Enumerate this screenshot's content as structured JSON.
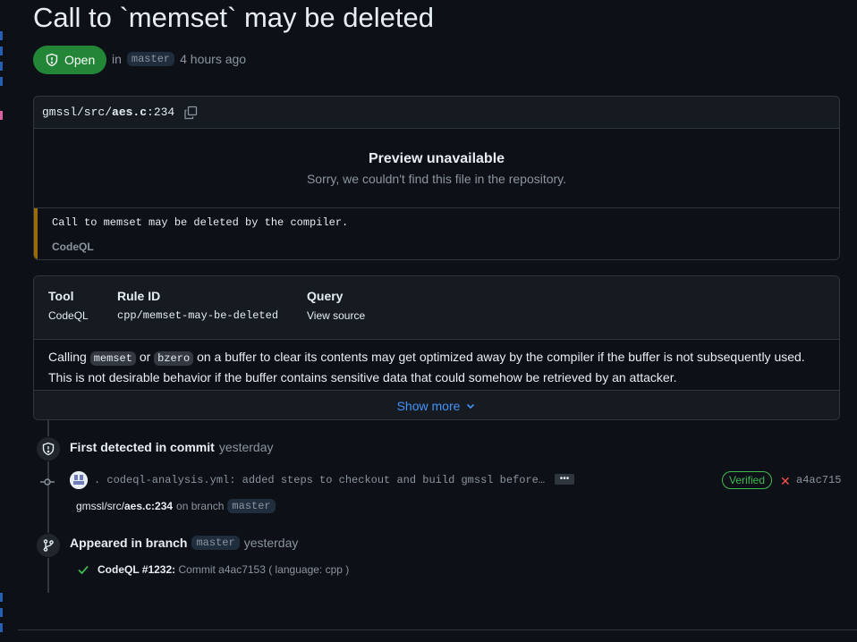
{
  "alert": {
    "title": "Call to `memset` may be deleted",
    "status": "Open",
    "in_label": "in",
    "branch": "master",
    "time_ago": "4 hours ago"
  },
  "file": {
    "path_prefix": "gmssl/src/",
    "filename": "aes.c",
    "line": ":234",
    "preview_title": "Preview unavailable",
    "preview_message": "Sorry, we couldn't find this file in the repository.",
    "alert_message": "Call to memset may be deleted by the compiler.",
    "alert_tool": "CodeQL"
  },
  "rule": {
    "tool_header": "Tool",
    "tool_value": "CodeQL",
    "rule_id_header": "Rule ID",
    "rule_id_value": "cpp/memset-may-be-deleted",
    "query_header": "Query",
    "query_value": "View source",
    "desc_part1": "Calling",
    "code1": "memset",
    "desc_or": "or",
    "code2": "bzero",
    "desc_part2": "on a buffer to clear its contents may get optimized away by the compiler if the buffer is not subsequently used.",
    "desc_line2": "This is not desirable behavior if the buffer contains sensitive data that could somehow be retrieved by an attacker.",
    "show_more": "Show more"
  },
  "timeline": {
    "first_detected_bold": "First detected in commit",
    "first_detected_time": "yesterday",
    "commit_message": ". codeql-analysis.yml: added steps to checkout and build gmssl before…",
    "ellipsis": "•••",
    "verified": "Verified",
    "sha": "a4ac715",
    "loc_path": "gmssl/src/",
    "loc_file": "aes.c:234",
    "loc_on_branch": "on branch",
    "loc_branch": "master",
    "appeared_bold": "Appeared in branch",
    "appeared_branch": "master",
    "appeared_time": "yesterday",
    "analysis_bold": "CodeQL #1232:",
    "analysis_text": "Commit a4ac7153 ( language: cpp )"
  },
  "colors": {
    "background": "#0d1117",
    "open_green": "#238636",
    "link_blue": "#4493f8",
    "warning_border": "#9e6a03",
    "verified_green": "#3fb950",
    "fail_red": "#f85149"
  },
  "icons": [
    "shield-alert-icon",
    "copy-icon",
    "chevron-down-icon",
    "shield-icon",
    "git-commit-icon",
    "git-branch-icon",
    "check-icon",
    "x-icon"
  ]
}
